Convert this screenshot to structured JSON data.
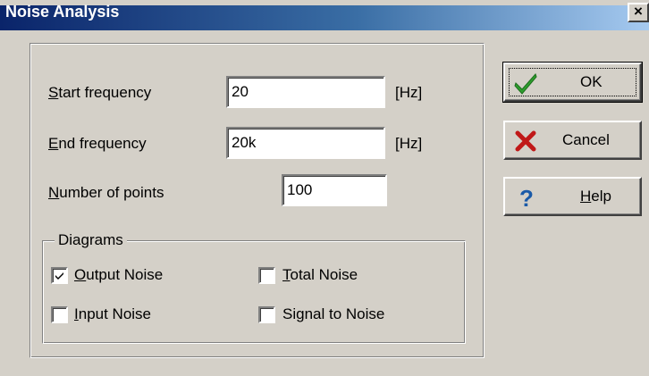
{
  "window": {
    "title": "Noise Analysis",
    "close_glyph": "×"
  },
  "fields": {
    "start_frequency": {
      "label_key": "S",
      "label_rest": "tart frequency",
      "value": "20",
      "unit": "[Hz]"
    },
    "end_frequency": {
      "label_key": "E",
      "label_rest": "nd frequency",
      "value": "20k",
      "unit": "[Hz]"
    },
    "number_of_points": {
      "label_key": "N",
      "label_rest": "umber of points",
      "value": "100"
    }
  },
  "diagrams": {
    "legend": "Diagrams",
    "output_noise": {
      "key": "O",
      "rest": "utput Noise",
      "checked": true
    },
    "total_noise": {
      "key": "T",
      "rest": "otal Noise",
      "checked": false
    },
    "input_noise": {
      "key": "I",
      "rest": "nput Noise",
      "checked": false
    },
    "signal_to_noise": {
      "pre": "Si",
      "key": "g",
      "rest": "nal to Noise",
      "checked": false
    }
  },
  "buttons": {
    "ok": {
      "label": "OK",
      "icon": "checkmark-icon",
      "color": "#2e9e2e"
    },
    "cancel": {
      "label": "Cancel",
      "icon": "x-icon",
      "color": "#c01818"
    },
    "help": {
      "key": "H",
      "rest": "elp",
      "icon": "question-icon",
      "color": "#1a5aa8"
    }
  }
}
